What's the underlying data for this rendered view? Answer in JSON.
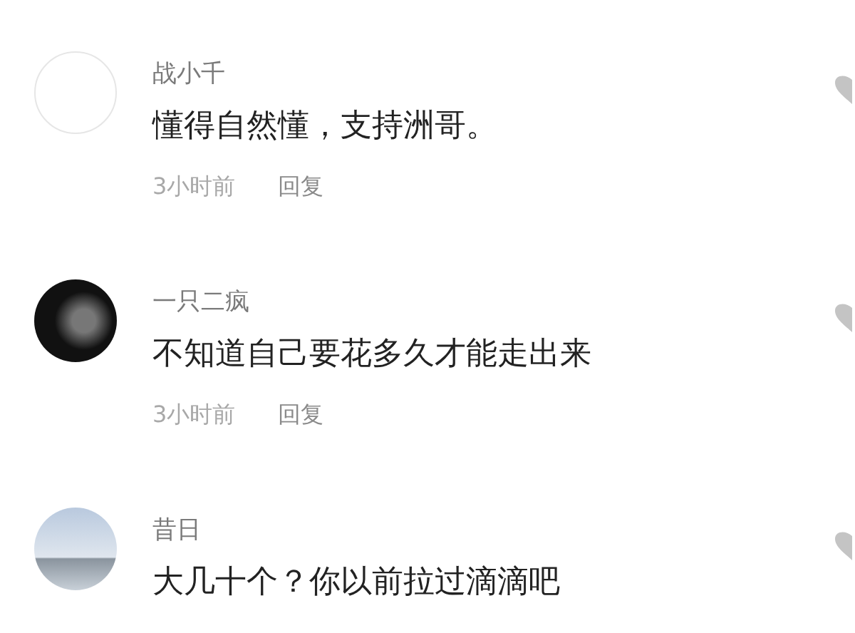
{
  "comments": [
    {
      "kind": "blank",
      "user": "战小千",
      "text": "懂得自然懂，支持洲哥。",
      "time": "3小时前",
      "reply": "回复"
    },
    {
      "kind": "dark",
      "user": "一只二疯",
      "text": "不知道自己要花多久才能走出来",
      "time": "3小时前",
      "reply": "回复"
    },
    {
      "kind": "sky",
      "user": "昔日",
      "text": "大几十个？你以前拉过滴滴吧"
    }
  ]
}
